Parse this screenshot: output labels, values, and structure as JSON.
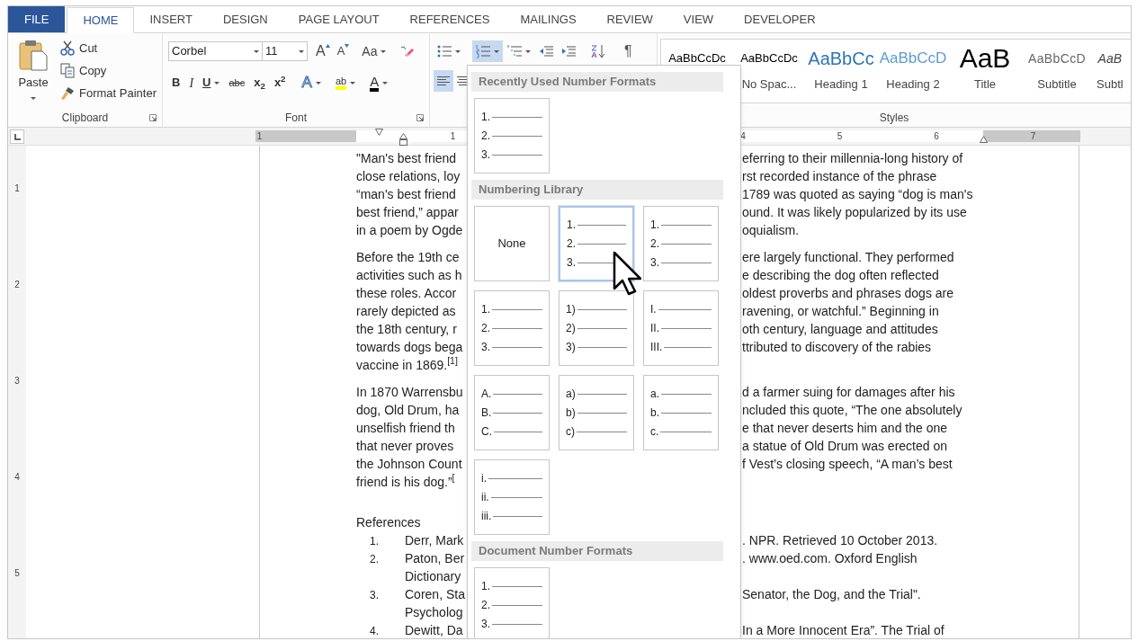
{
  "tabs": [
    {
      "label": "FILE",
      "kind": "file",
      "selected": false
    },
    {
      "label": "HOME",
      "kind": "tab",
      "selected": true
    },
    {
      "label": "INSERT",
      "kind": "tab",
      "selected": false
    },
    {
      "label": "DESIGN",
      "kind": "tab",
      "selected": false
    },
    {
      "label": "PAGE LAYOUT",
      "kind": "tab",
      "selected": false
    },
    {
      "label": "REFERENCES",
      "kind": "tab",
      "selected": false
    },
    {
      "label": "MAILINGS",
      "kind": "tab",
      "selected": false
    },
    {
      "label": "REVIEW",
      "kind": "tab",
      "selected": false
    },
    {
      "label": "VIEW",
      "kind": "tab",
      "selected": false
    },
    {
      "label": "DEVELOPER",
      "kind": "tab",
      "selected": false
    }
  ],
  "clipboard": {
    "paste": "Paste",
    "actions": [
      {
        "kind": "cut",
        "label": "Cut"
      },
      {
        "kind": "copy",
        "label": "Copy"
      },
      {
        "kind": "painter",
        "label": "Format Painter"
      }
    ],
    "label": "Clipboard"
  },
  "font": {
    "name": "Corbel",
    "size": "11",
    "top_buttons": [
      {
        "kind": "grow",
        "text": "A"
      },
      {
        "kind": "shrink",
        "text": "A"
      },
      {
        "kind": "case",
        "text": "Aa"
      }
    ],
    "bottom_buttons": [
      {
        "kind": "bold",
        "text": "B"
      },
      {
        "kind": "italic",
        "text": "I"
      },
      {
        "kind": "underline",
        "text": "U"
      },
      {
        "kind": "strike",
        "text": "abc"
      },
      {
        "kind": "sub",
        "text": "x$_{2}$"
      },
      {
        "kind": "sup",
        "text": "x$^{2}$"
      },
      {
        "kind": "effects",
        "text": "A"
      },
      {
        "kind": "highlight",
        "text": "ab"
      },
      {
        "kind": "color",
        "text": "A"
      }
    ],
    "label": "Font"
  },
  "paragraph": {
    "top_buttons": [
      {
        "kind": "bullets",
        "selected": false
      },
      {
        "kind": "numbering",
        "selected": true
      },
      {
        "kind": "multilevel",
        "selected": false
      },
      {
        "kind": "outdent",
        "selected": false
      },
      {
        "kind": "indent",
        "selected": false
      },
      {
        "kind": "sort",
        "selected": false
      },
      {
        "kind": "pilcrow",
        "text": "¶",
        "selected": false
      }
    ],
    "bottom_buttons": [
      {
        "kind": "align-left",
        "selected": true
      },
      {
        "kind": "align-center",
        "selected": false
      }
    ]
  },
  "styles": {
    "items": [
      {
        "kind": "normal",
        "preview": "AaBbCcDc"
      },
      {
        "kind": "normal",
        "preview": "AaBbCcDc",
        "label": "No Spac..."
      },
      {
        "kind": "heading1",
        "preview": "AaBbCc",
        "label": "Heading 1"
      },
      {
        "kind": "heading2",
        "preview": "AaBbCcD",
        "label": "Heading 2"
      },
      {
        "kind": "title",
        "preview": "AaB",
        "label": "Title"
      },
      {
        "kind": "subtitle",
        "preview": "AaBbCcD",
        "label": "Subtitle"
      },
      {
        "kind": "emphasis",
        "preview": "AaB",
        "label": "Subtl"
      }
    ],
    "label": "Styles"
  },
  "ruler": {
    "numbers": [
      "1",
      "1",
      "4",
      "5",
      "6",
      "7"
    ],
    "vertical_numbers": [
      "1",
      "2",
      "3",
      "4",
      "5"
    ]
  },
  "document": {
    "paragraphs": [
      {
        "lines": [
          {
            "left": "\"Man's best friend",
            "right": "eferring to their millennia-long history of"
          },
          {
            "left": "close relations, loy",
            "right": "rst recorded instance of the phrase"
          },
          {
            "left": "“man's best friend",
            "right": "1789 was quoted as saying “dog is man's"
          },
          {
            "left": "best friend,” appar",
            "right": "ound. It was likely popularized by its use"
          },
          {
            "left": "in a poem by Ogde",
            "right": "oquialism."
          }
        ]
      },
      {
        "lines": [
          {
            "left": "Before the 19th ce",
            "right": "ere largely functional. They performed"
          },
          {
            "left": "activities such as h",
            "right": "e describing the dog often reflected"
          },
          {
            "left": "these roles. Accor",
            "right": "oldest proverbs and phrases dogs are"
          },
          {
            "left": "rarely depicted as",
            "right": "ravening, or watchful.” Beginning in"
          },
          {
            "left": "the 18th century, r",
            "right": "oth century, language and attitudes"
          },
          {
            "left": "towards dogs bega",
            "right": "ttributed to discovery of the rabies"
          },
          {
            "left": "vaccine in 1869.$^{[1]}$"
          }
        ]
      },
      {
        "lines": [
          {
            "left": "In 1870 Warrensbu",
            "right": "d a farmer suing for damages after his"
          },
          {
            "left": "dog, Old Drum, ha",
            "right": "ncluded this quote, “The one absolutely"
          },
          {
            "left": "unselfish friend th",
            "right": "e that never deserts him and the one"
          },
          {
            "left": "that never proves",
            "right": "a statue of Old Drum was erected on"
          },
          {
            "left": "the Johnson Count",
            "right": "f Vest’s closing speech, “A man’s best"
          },
          {
            "left": "friend is his dog.”$^{[}$"
          }
        ]
      }
    ],
    "references_title": "References",
    "references": [
      {
        "number": "1.",
        "lines": [
          {
            "left": "Derr, Mark",
            "right": ". NPR. Retrieved 10 October 2013."
          }
        ]
      },
      {
        "number": "2.",
        "lines": [
          {
            "left": "Paton, Ber",
            "right": ". www.oed.com. Oxford English"
          },
          {
            "left": "Dictionary"
          }
        ]
      },
      {
        "number": "3.",
        "lines": [
          {
            "left": "Coren, Sta",
            "right": "Senator, the Dog, and the Trial\"."
          },
          {
            "left": "Psycholog"
          }
        ]
      },
      {
        "number": "4.",
        "lines": [
          {
            "left": "Dewitt, Da",
            "right": "In a More Innocent Era”. The Trial of"
          }
        ]
      }
    ]
  },
  "numbering_menu": {
    "sections": [
      {
        "title": "Recently Used Number Formats",
        "items": [
          {
            "kind": "list",
            "markers": [
              "1.",
              "2.",
              "3."
            ],
            "hovered": false
          }
        ]
      },
      {
        "title": "Numbering Library",
        "items": [
          {
            "kind": "none",
            "label": "None",
            "hovered": false
          },
          {
            "kind": "list",
            "markers": [
              "1.",
              "2.",
              "3."
            ],
            "hovered": true
          },
          {
            "kind": "list",
            "markers": [
              "1.",
              "2.",
              "3."
            ],
            "hovered": false
          },
          {
            "kind": "list",
            "markers": [
              "1.",
              "2.",
              "3."
            ],
            "hovered": false
          },
          {
            "kind": "list",
            "markers": [
              "1)",
              "2)",
              "3)"
            ],
            "hovered": false
          },
          {
            "kind": "list",
            "markers": [
              "I.",
              "II.",
              "III."
            ],
            "hovered": false
          },
          {
            "kind": "list",
            "markers": [
              "A.",
              "B.",
              "C."
            ],
            "hovered": false
          },
          {
            "kind": "list",
            "markers": [
              "a)",
              "b)",
              "c)"
            ],
            "hovered": false
          },
          {
            "kind": "list",
            "markers": [
              "a.",
              "b.",
              "c."
            ],
            "hovered": false
          },
          {
            "kind": "list",
            "markers": [
              "i.",
              "ii.",
              "iii."
            ],
            "hovered": false
          }
        ]
      },
      {
        "title": "Document Number Formats",
        "items": [
          {
            "kind": "list",
            "markers": [
              "1.",
              "2.",
              "3."
            ],
            "hovered": false
          }
        ]
      }
    ]
  }
}
